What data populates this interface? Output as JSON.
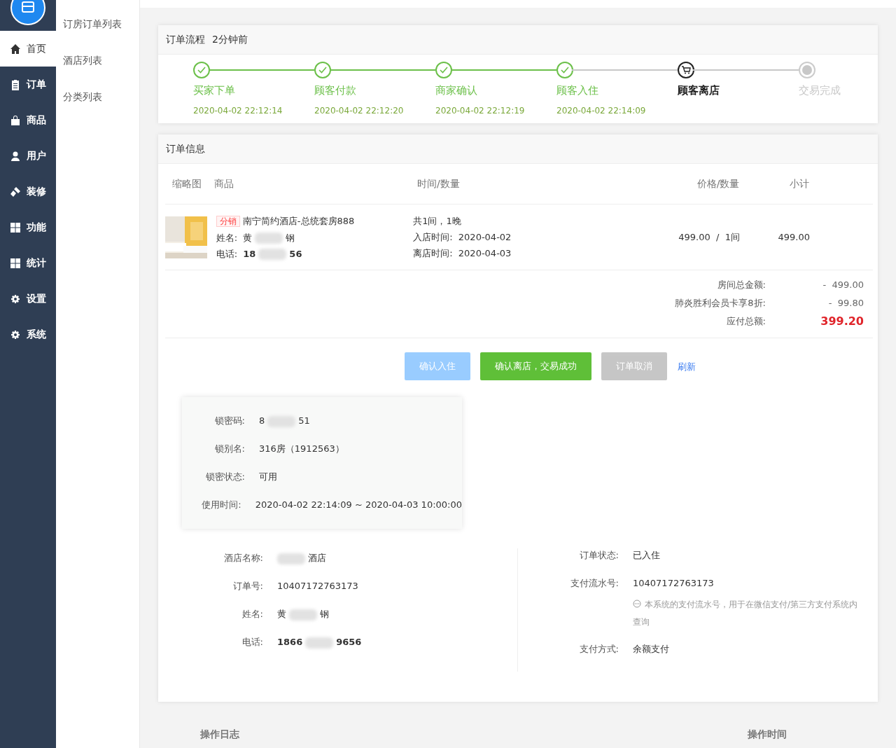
{
  "sidebar": {
    "items": [
      {
        "label": "首页",
        "selected": true
      },
      {
        "label": "订单",
        "selected": false
      },
      {
        "label": "商品",
        "selected": false
      },
      {
        "label": "用户",
        "selected": false
      },
      {
        "label": "装修",
        "selected": false
      },
      {
        "label": "功能",
        "selected": false
      },
      {
        "label": "统计",
        "selected": false
      },
      {
        "label": "设置",
        "selected": false
      },
      {
        "label": "系统",
        "selected": false
      }
    ]
  },
  "submenu": {
    "items": [
      "订房订单列表",
      "酒店列表",
      "分类列表"
    ]
  },
  "flow": {
    "title": "订单流程",
    "time": "2分钟前",
    "steps": [
      {
        "label": "买家下单",
        "time": "2020-04-02 22:12:14",
        "completed": true,
        "current": false
      },
      {
        "label": "顾客付款",
        "time": "2020-04-02 22:12:20",
        "completed": true,
        "current": false
      },
      {
        "label": "商家确认",
        "time": "2020-04-02 22:12:19",
        "completed": true,
        "current": false
      },
      {
        "label": "顾客入住",
        "time": "2020-04-02 22:14:09",
        "completed": true,
        "current": false
      },
      {
        "label": "顾客离店",
        "completed": false,
        "current": true
      },
      {
        "label": "交易完成",
        "completed": false,
        "current": false
      }
    ]
  },
  "order": {
    "title": "订单信息",
    "table": {
      "columns": [
        "缩略图",
        "商品",
        "时间/数量",
        "价格/数量",
        "小计"
      ],
      "rows": [
        {
          "thumbnail": {
            "kind": "picture"
          },
          "tag": "分销",
          "product": "南宁简约酒店-总统套房888",
          "name_label": "姓名:",
          "name_parts": [
            "黄",
            "钢"
          ],
          "phone_label": "电话:",
          "phone_parts": [
            "18",
            "56"
          ],
          "quantity": "共1间，1晚",
          "checkin": "入店时间:  2020-04-02",
          "checkout": "离店时间:  2020-04-03",
          "price": "499.00  /  1间",
          "subtotal": "499.00"
        }
      ]
    },
    "totals": [
      {
        "label": "房间总金额:",
        "value": "-  499.00",
        "emphasis": false
      },
      {
        "label": "肺炎胜利会员卡享8折:",
        "value": "-  99.80",
        "emphasis": false
      },
      {
        "label": "应付总额:",
        "value": "399.20",
        "emphasis": true
      }
    ],
    "actions": [
      {
        "label": "确认入住",
        "kind": "primary",
        "disabled": true
      },
      {
        "label": "确认离店，交易成功",
        "kind": "success",
        "disabled": false
      },
      {
        "label": "订单取消",
        "kind": "secondary",
        "disabled": true
      },
      {
        "label": "刷新",
        "kind": "link",
        "disabled": false
      }
    ],
    "lock": [
      {
        "label": "锁密码:",
        "parts": [
          "8",
          "51"
        ]
      },
      {
        "label": "锁别名:",
        "parts": [
          "316房（1912563）"
        ]
      },
      {
        "label": "锁密状态:",
        "parts": [
          "可用"
        ]
      },
      {
        "label": "使用时间:",
        "parts": [
          "2020-04-02 22:14:09 ~ 2020-04-03 10:00:00"
        ]
      }
    ],
    "details_left": [
      {
        "label": "酒店名称:",
        "masked_start": true,
        "parts": [
          "酒店"
        ]
      },
      {
        "label": "订单号:",
        "parts": [
          "10407172763173"
        ],
        "bold": false
      },
      {
        "label": "姓名:",
        "parts": [
          "黄",
          "钢"
        ],
        "bold": false
      },
      {
        "label": "电话:",
        "parts": [
          "1866",
          "9656"
        ],
        "bold": true
      }
    ],
    "details_right": [
      {
        "label": "订单状态:",
        "parts": [
          "已入住"
        ]
      },
      {
        "label": "支付流水号:",
        "parts": [
          "10407172763173"
        ],
        "hint": "本系统的支付流水号，用于在微信支付/第三方支付系统内查询"
      },
      {
        "label": "支付方式:",
        "parts": [
          "余额支付"
        ]
      }
    ]
  },
  "log": {
    "columns": [
      "操作日志",
      "操作时间"
    ]
  }
}
